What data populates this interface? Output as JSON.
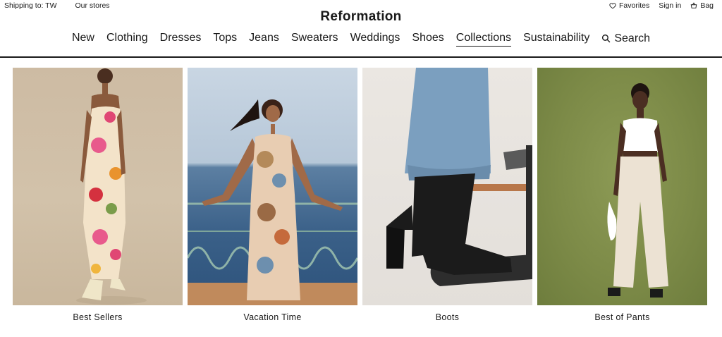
{
  "topbar": {
    "shipping_label": "Shipping to: TW",
    "stores_label": "Our stores",
    "favorites_label": "Favorites",
    "signin_label": "Sign in",
    "bag_label": "Bag"
  },
  "brand": {
    "name": "Reformation"
  },
  "nav": {
    "items": [
      "New",
      "Clothing",
      "Dresses",
      "Tops",
      "Jeans",
      "Sweaters",
      "Weddings",
      "Shoes",
      "Collections",
      "Sustainability"
    ],
    "active": "Collections",
    "search_label": "Search"
  },
  "tiles": [
    {
      "caption": "Best Sellers"
    },
    {
      "caption": "Vacation Time"
    },
    {
      "caption": "Boots"
    },
    {
      "caption": "Best of Pants"
    }
  ],
  "colors": {
    "text": "#1a1a1a",
    "background": "#ffffff",
    "divider": "#1a1a1a"
  }
}
